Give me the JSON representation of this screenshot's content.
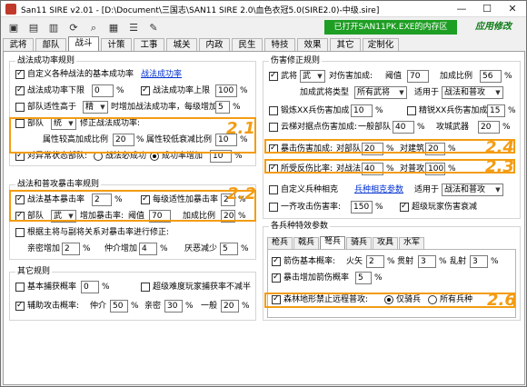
{
  "window": {
    "title": "San11 SIRE v2.01 - [D:\\Document\\三国志\\SAN11 SIRE 2.0\\血色衣冠5.0(SIRE2.0)-中级.sire]",
    "minimize": "—",
    "maximize": "☐",
    "close": "✕"
  },
  "toolbar": {
    "status": "已打开SAN11PK.EXE的内存区",
    "brand": "应用修改",
    "icons": [
      "open-icon",
      "save-icon",
      "save-as-icon",
      "refresh-icon",
      "zoom-icon",
      "grid-icon",
      "list-icon",
      "tools-icon"
    ]
  },
  "tabs": [
    "武将",
    "部队",
    "战斗",
    "计策",
    "工事",
    "城关",
    "内政",
    "民生",
    "特技",
    "效果",
    "其它",
    "定制化"
  ],
  "active_tab": "战斗",
  "left": {
    "success": {
      "title": "战法成功率规则",
      "custom_formula": "自定义各种战法的基本成功率",
      "custom_link": "战法成功率",
      "lower_limit_label": "战法成功率下限",
      "lower_limit_value": "0",
      "upper_limit_label": "战法成功率上限",
      "upper_limit_value": "100",
      "pct": "%",
      "troop_adapt_label": "部队适性高于",
      "troop_adapt_value": "精",
      "time_bonus_label": "时增加战法成功率，每级增加",
      "time_bonus_value": "5",
      "unit_label": "部队",
      "unit_value": "统",
      "fix_label": "修正战法成功率:",
      "high_label": "属性较高加成比例",
      "high_value": "20",
      "low_label": "属性较低衰减比例",
      "low_value": "10",
      "anomaly_label": "对异常状态部队:",
      "r1": "战法必成功",
      "r2": "成功率增加",
      "r2_value": "10"
    },
    "crit": {
      "title": "战法和普攻暴击率规则",
      "base_label": "战法基本暴击率",
      "base_value": "2",
      "per_level_label": "每级适性加暴击率",
      "per_level_value": "2",
      "unit_label": "部队",
      "unit_value": "武",
      "inc_label": "增加暴击率:",
      "threshold_label": "阈值",
      "threshold_value": "70",
      "ratio_label": "加成比例",
      "ratio_value": "20",
      "relation_label": "根据主将与副将关系对暴击率进行修正:",
      "kin_label": "亲密增加",
      "kin_value": "2",
      "match_label": "仲介增加",
      "match_value": "4",
      "hate_label": "厌恶减少",
      "hate_value": "5",
      "pct": "%"
    },
    "other": {
      "title": "其它规则",
      "base_capture_label": "基本捕获概率",
      "base_capture_value": "0",
      "hard_label": "超级难度玩家捕获率不减半",
      "assist_label": "辅助攻击概率:",
      "match_label": "仲介",
      "match_value": "50",
      "kin_label": "亲密",
      "kin_value": "30",
      "normal_label": "一般",
      "normal_value": "20",
      "pct": "%"
    }
  },
  "right": {
    "damage": {
      "title": "伤害修正规则",
      "general_label": "武将",
      "general_value": "武",
      "vs_general_label": "对伤害加成:",
      "threshold_label": "阈值",
      "threshold_value": "70",
      "ratio_label": "加成比例",
      "ratio_value": "56",
      "type_label": "加成武将类型",
      "type_value": "所有武将",
      "apply_label": "适用于",
      "apply_value": "战法和普攻",
      "xx_label": "锻炼XX兵伤害加成",
      "xx_value": "10",
      "fine_label": "精锐XX兵伤害加成",
      "fine_value": "15",
      "ladder_label": "云梯对据点伤害加成:",
      "normal_label": "一般部队",
      "normal_value": "40",
      "siege_label": "攻城武器",
      "siege_value": "20",
      "crit_dmg_label": "暴击伤害加成:",
      "vs_unit_label": "对部队",
      "vs_unit_value": "20",
      "vs_build_label": "对建筑",
      "vs_build_value": "20",
      "recv_label": "所受反伤比率:",
      "recv_tactic_label": "对战法",
      "recv_tactic_value": "40",
      "recv_normal_label": "对普攻",
      "recv_normal_value": "100",
      "custom_label": "自定义兵种相克",
      "custom_link": "兵种相克参数",
      "apply2_label": "适用于",
      "apply2_value": "战法和普攻",
      "one_side_label": "一齐攻击伤害率:",
      "one_side_value": "150",
      "hard_label": "超级玩家伤害衰减",
      "pct": "%"
    },
    "features": {
      "title": "各兵种特效参数",
      "subtabs": [
        "枪兵",
        "戟兵",
        "弩兵",
        "骑兵",
        "攻具",
        "水军"
      ],
      "active_subtab": "弩兵",
      "arrow_base_label": "箭伤基本概率:",
      "fire_label": "火矢",
      "fire_value": "2",
      "pierce_label": "贯射",
      "pierce_value": "3",
      "random_label": "乱射",
      "random_value": "3",
      "crit_add_label": "暴击增加箭伤概率",
      "crit_add_value": "5",
      "pct": "%",
      "forest_label": "森林地形禁止远程普攻:",
      "fr1": "仅骑兵",
      "fr2": "所有兵种"
    }
  },
  "annotations": {
    "a21": "2.1",
    "a22": "2.2",
    "a23": "2.3",
    "a24": "2.4",
    "a26": "2.6",
    "color": "#f39c12"
  }
}
